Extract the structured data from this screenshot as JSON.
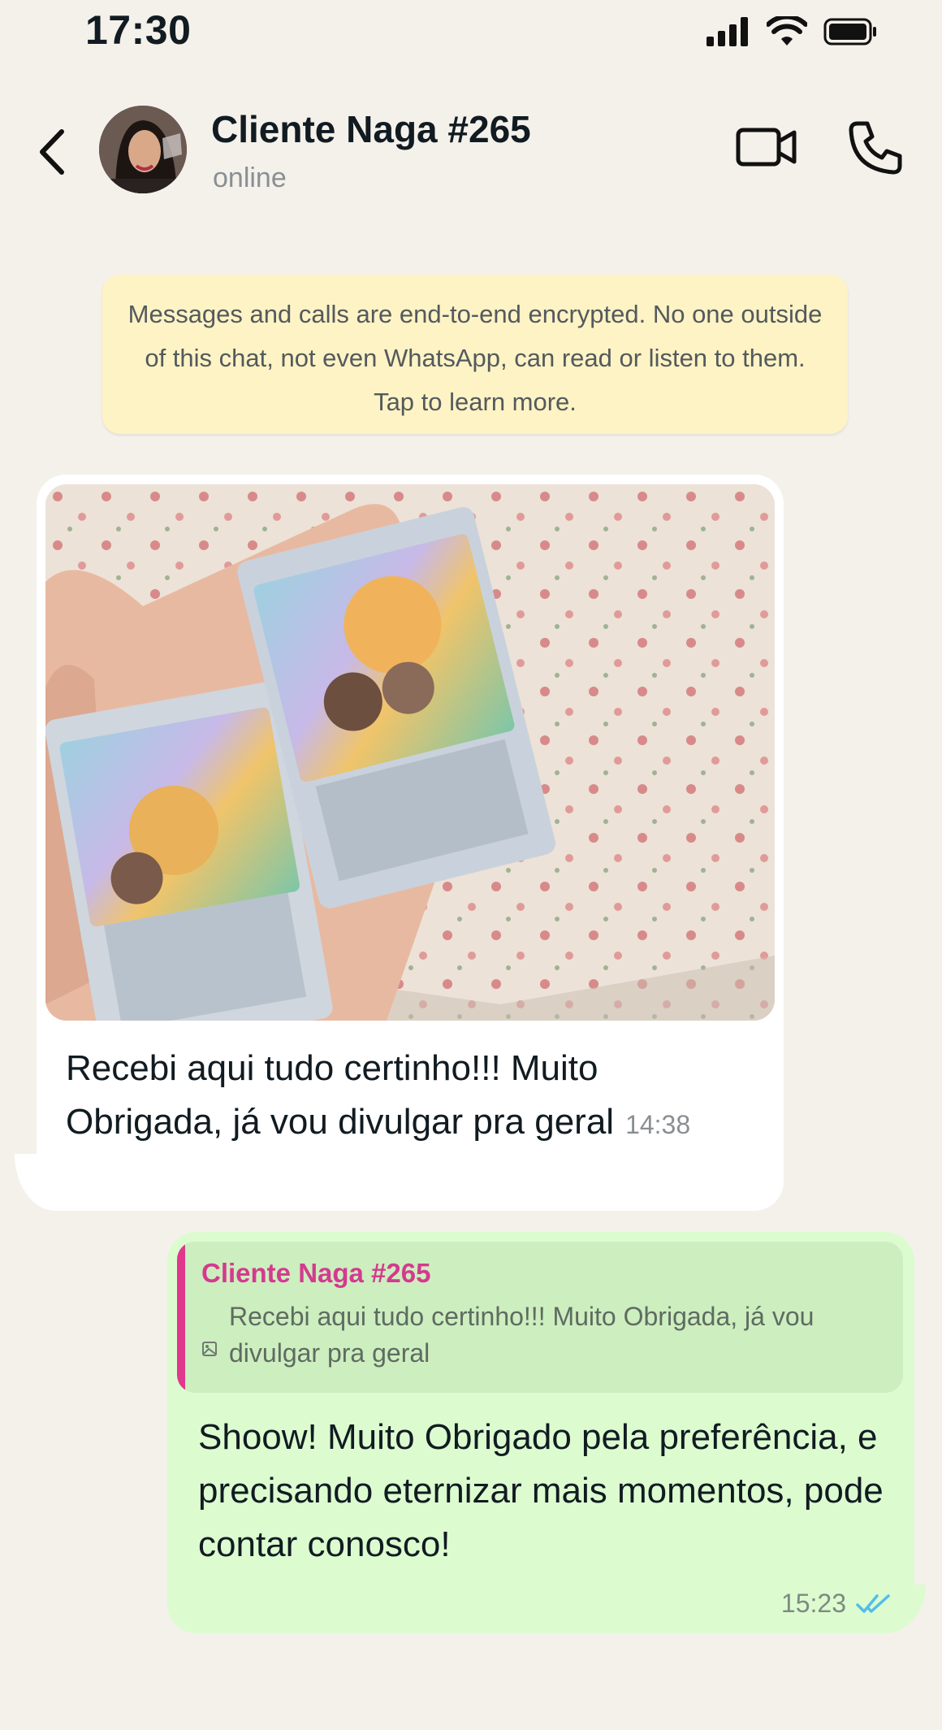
{
  "status_bar": {
    "time": "17:30"
  },
  "header": {
    "contact_name": "Cliente Naga #265",
    "contact_status": "online"
  },
  "encryption_notice": "Messages and calls are end-to-end encrypted. No one outside of this chat, not even WhatsApp, can read or listen to them. Tap to learn more.",
  "messages": [
    {
      "direction": "incoming",
      "has_photo": true,
      "text": "Recebi aqui tudo certinho!!! Muito Obrigada, já vou divulgar pra geral",
      "time": "14:38"
    },
    {
      "direction": "outgoing",
      "quote": {
        "author": "Cliente Naga #265",
        "text": "Recebi aqui tudo certinho!!! Muito Obrigada, já vou divulgar pra geral"
      },
      "text": "Shoow! Muito Obrigado pela preferência, e precisando eternizar mais momentos, pode contar conosco!",
      "time": "15:23",
      "receipt": "double-check-icon"
    }
  ],
  "colors": {
    "background": "#f4f1eb",
    "incoming_bubble": "#ffffff",
    "outgoing_bubble": "#dcfcd0",
    "quote_accent": "#e0388c",
    "read_receipt": "#53bdeb",
    "notice_bg": "#fdf3c4"
  }
}
